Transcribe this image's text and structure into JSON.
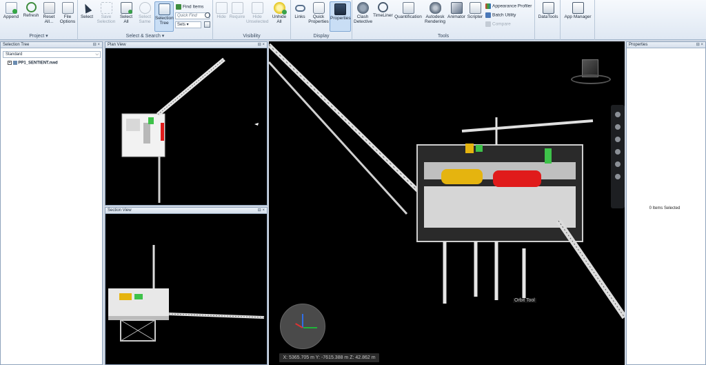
{
  "ribbon": {
    "project": {
      "label": "Project",
      "buttons": [
        "Append",
        "Refresh",
        "Reset All...",
        "File Options"
      ]
    },
    "select_search": {
      "label": "Select & Search",
      "buttons": [
        "Select",
        "Save Selection",
        "Select All",
        "Select Same",
        "Selection Tree"
      ],
      "find_items": "Find Items",
      "quick_find_placeholder": "Quick Find",
      "sets": "Sets"
    },
    "visibility": {
      "label": "Visibility",
      "buttons": [
        "Hide",
        "Require",
        "Hide Unselected",
        "Unhide All"
      ]
    },
    "display": {
      "label": "Display",
      "buttons": [
        "Links",
        "Quick Properties",
        "Properties"
      ]
    },
    "tools": {
      "label": "Tools",
      "buttons": [
        "Clash Detective",
        "TimeLiner",
        "Quantification",
        "Autodesk Rendering",
        "Animator",
        "Scripter"
      ],
      "appearance_profiler": "Appearance Profiler",
      "batch_utility": "Batch Utility",
      "compare": "Compare"
    },
    "datatools": "DataTools",
    "app_manager": "App Manager"
  },
  "selection_tree": {
    "title": "Selection Tree",
    "mode": "Standard",
    "root_item": "PP1_SENTIENT.nwd"
  },
  "plan_view": {
    "title": "Plan View"
  },
  "section_view": {
    "title": "Section View"
  },
  "properties": {
    "title": "Properties",
    "status": "0 Items Selected"
  },
  "viewport": {
    "orbit_tooltip": "Orbit Tool",
    "coordinates": "X: 5365.705 m  Y: -7615.388 m  Z: 42.862 m"
  },
  "colors": {
    "ribbon_bg": "#e6edf6",
    "viewport_bg": "#000000",
    "model_lines": "#d9dde2",
    "equipment_yellow": "#e5b40f",
    "equipment_red": "#e01b1b",
    "equipment_green": "#3ec24a"
  }
}
